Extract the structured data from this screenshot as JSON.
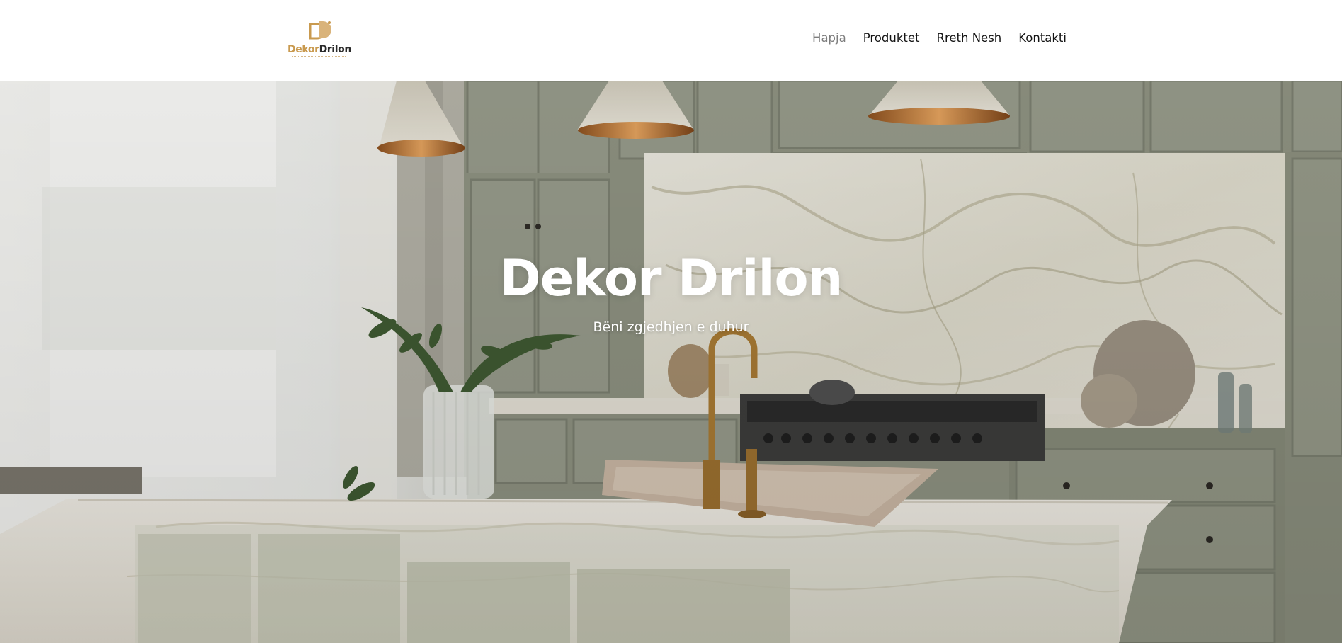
{
  "header": {
    "logo": {
      "word1": "Dekor",
      "word2": "Drilon"
    },
    "nav": [
      {
        "label": "Hapja",
        "active": true
      },
      {
        "label": "Produktet",
        "active": false
      },
      {
        "label": "Rreth Nesh",
        "active": false
      },
      {
        "label": "Kontakti",
        "active": false
      }
    ]
  },
  "hero": {
    "title": "Dekor Drilon",
    "subtitle": "Bëni zgjedhjen e duhur"
  },
  "colors": {
    "brand_gold": "#c99a4f",
    "nav_text": "#141414",
    "nav_active": "#7d7d7d",
    "cabinet_green": "#8f9382"
  }
}
